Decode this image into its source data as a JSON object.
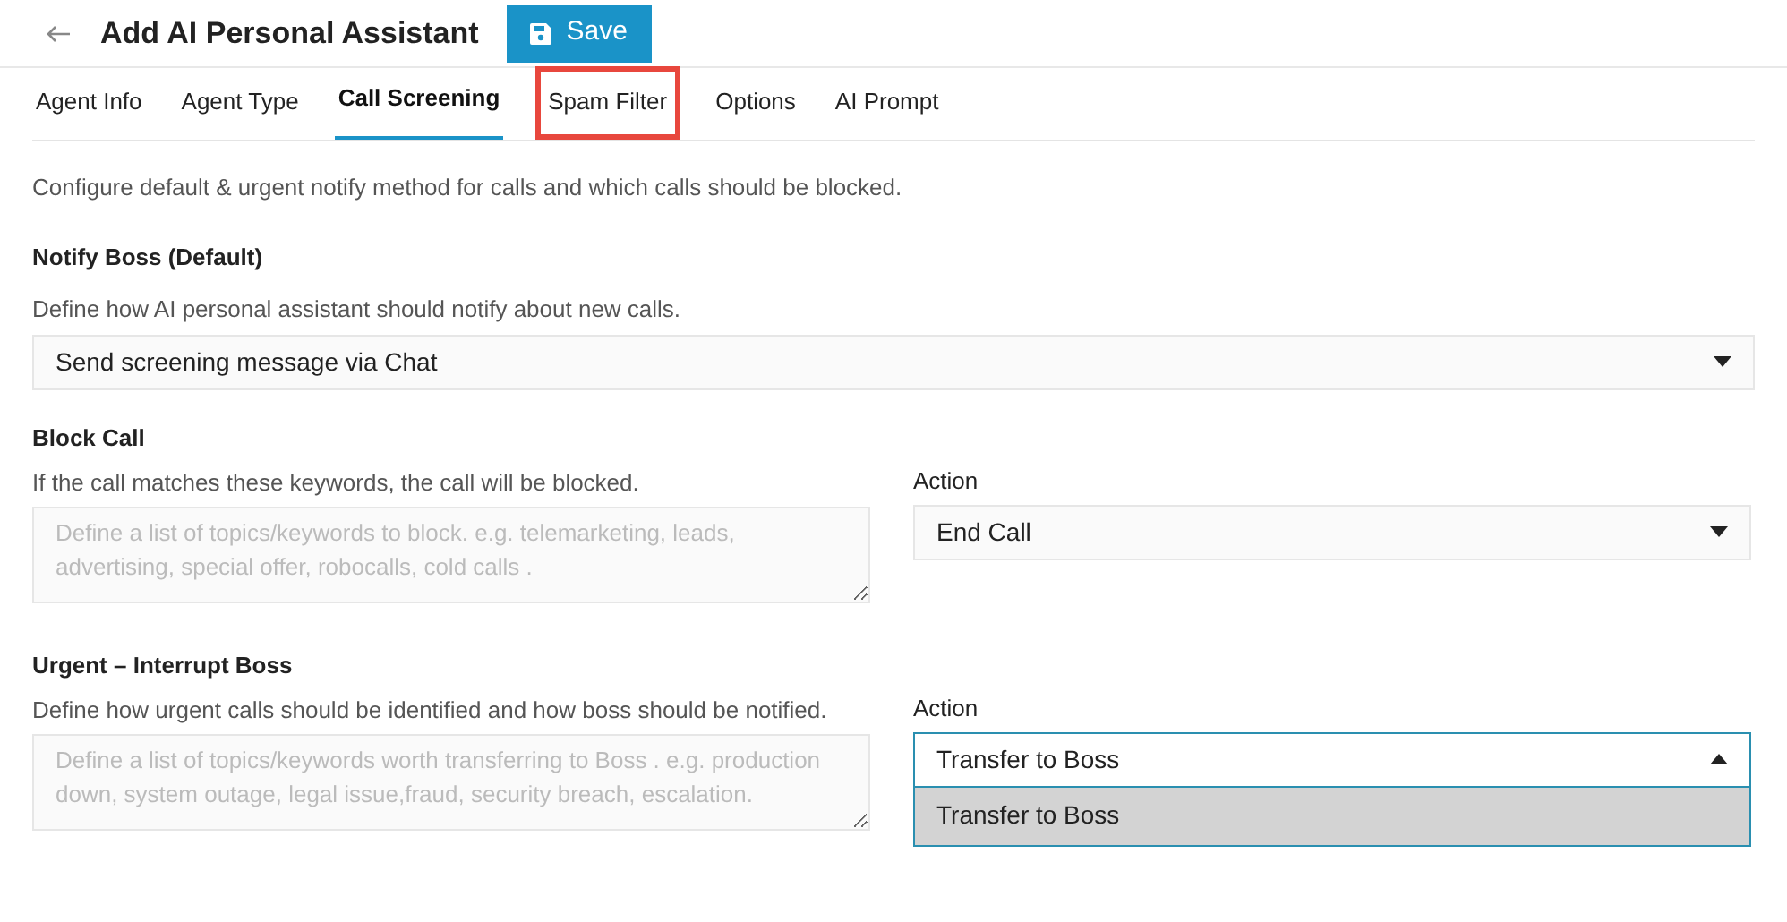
{
  "header": {
    "title": "Add AI Personal Assistant",
    "save_label": "Save"
  },
  "tabs": [
    {
      "label": "Agent Info",
      "selected": false,
      "highlighted": false
    },
    {
      "label": "Agent Type",
      "selected": false,
      "highlighted": false
    },
    {
      "label": "Call Screening",
      "selected": true,
      "highlighted": false
    },
    {
      "label": "Spam Filter",
      "selected": false,
      "highlighted": true
    },
    {
      "label": "Options",
      "selected": false,
      "highlighted": false
    },
    {
      "label": "AI Prompt",
      "selected": false,
      "highlighted": false
    }
  ],
  "intro": "Configure default & urgent notify method for calls and which calls should be blocked.",
  "notify": {
    "heading": "Notify Boss (Default)",
    "description": "Define how AI personal assistant should notify about new calls.",
    "select": {
      "value": "Send screening message via Chat",
      "expanded": false
    }
  },
  "sections": [
    {
      "heading": "Block Call",
      "description": "If the call matches these keywords, the call will be blocked.",
      "placeholder": "Define a list of topics/keywords to block. e.g. telemarketing, leads, advertising, special offer, robocalls, cold calls .",
      "action_label": "Action",
      "action": {
        "value": "End Call",
        "expanded": false
      }
    },
    {
      "heading": "Urgent – Interrupt Boss",
      "description": "Define how urgent calls should be identified and how boss should be notified.",
      "placeholder": "Define a list of topics/keywords worth transferring to Boss . e.g. production down, system outage, legal issue,fraud, security breach, escalation.",
      "action_label": "Action",
      "action": {
        "value": "Transfer to Boss",
        "expanded": true,
        "options": [
          {
            "label": "Transfer to Boss",
            "selected": true
          }
        ]
      }
    }
  ]
}
